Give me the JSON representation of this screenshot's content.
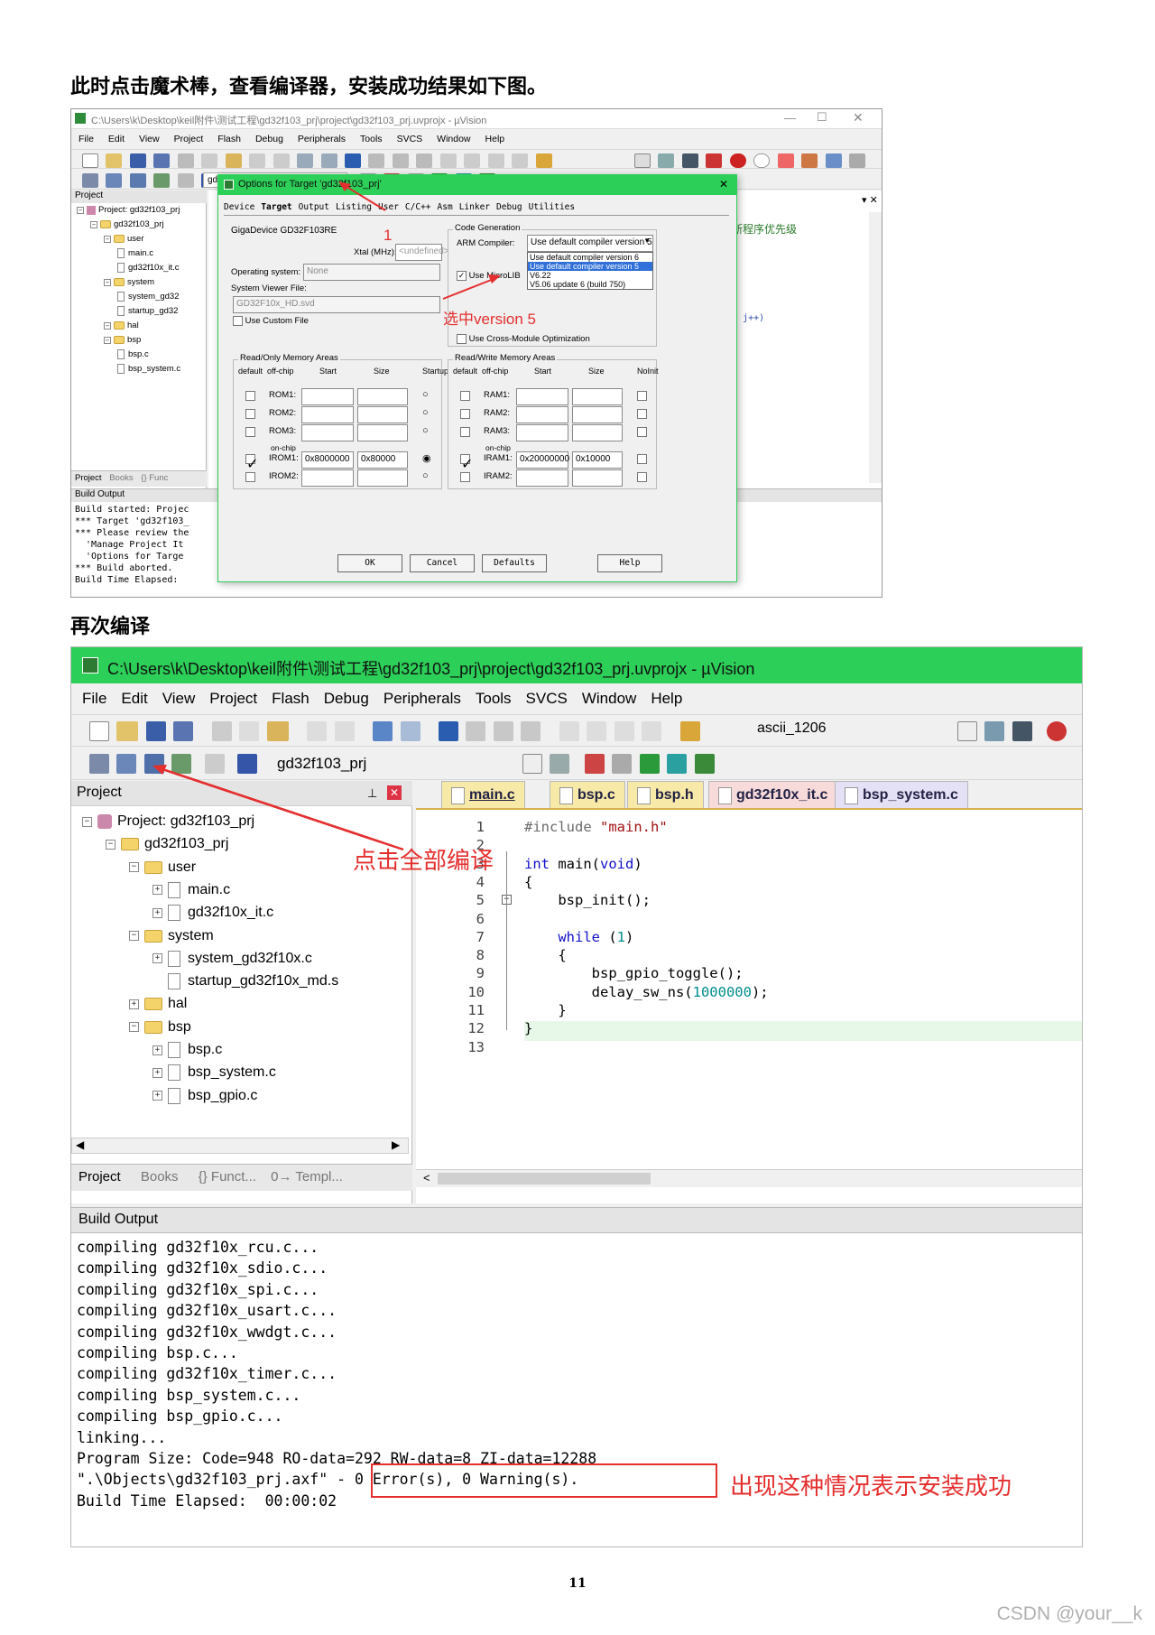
{
  "heading1": "此时点击魔术棒，查看编译器，安装成功结果如下图。",
  "heading2": "再次编译",
  "page_number": "11",
  "watermark": "CSDN @your__k",
  "shot1": {
    "title": "C:\\Users\\k\\Desktop\\keil附件\\测试工程\\gd32f103_prj\\project\\gd32f103_prj.uvprojx - µVision",
    "menu": [
      "File",
      "Edit",
      "View",
      "Project",
      "Flash",
      "Debug",
      "Peripherals",
      "Tools",
      "SVCS",
      "Window",
      "Help"
    ],
    "target": "gd32f103_prj",
    "project_panel_title": "Project",
    "tree": [
      "Project: gd32f103_prj",
      "gd32f103_prj",
      "user",
      "main.c",
      "gd32f10x_it.c",
      "system",
      "system_gd32",
      "startup_gd32",
      "hal",
      "bsp",
      "bsp.c",
      "bsp_system.c"
    ],
    "panel_tabs": [
      "Project",
      "Books",
      "{} Func"
    ],
    "build_output_title": "Build Output",
    "build_lines": [
      "Build started: Projec",
      "*** Target 'gd32f103_",
      "*** Please review the",
      "  'Manage Project It",
      "  'Options for Targe",
      "*** Build aborted.",
      "Build Time Elapsed:"
    ],
    "code_snippets": [
      "中断程序优先级",
      "2U; j++)"
    ],
    "dialog": {
      "title": "Options for Target 'gd32f103_prj'",
      "tabs": [
        "Device",
        "Target",
        "Output",
        "Listing",
        "User",
        "C/C++",
        "Asm",
        "Linker",
        "Debug",
        "Utilities"
      ],
      "device": "GigaDevice GD32F103RE",
      "xtal_label": "Xtal (MHz):",
      "xtal_value": "<undefined>",
      "os_label": "Operating system:",
      "os_value": "None",
      "svd_label": "System Viewer File:",
      "svd_value": "GD32F10x_HD.svd",
      "use_custom_file": "Use Custom File",
      "code_gen_title": "Code Generation",
      "arm_compiler_label": "ARM Compiler:",
      "arm_compiler_value": "Use default compiler version 5",
      "compiler_options": [
        "Use default compiler version 6",
        "Use default compiler version 5",
        "V6.22",
        "V5.06 update 6 (build 750)"
      ],
      "use_microlib": "Use MicroLIB",
      "cross_module": "Use Cross-Module Optimization",
      "ro_title": "Read/Only Memory Areas",
      "rw_title": "Read/Write Memory Areas",
      "ro_headers": [
        "default",
        "off-chip",
        "Start",
        "Size",
        "Startup"
      ],
      "rw_headers": [
        "default",
        "off-chip",
        "Start",
        "Size",
        "NoInit"
      ],
      "ro_rows": [
        {
          "name": "ROM1:",
          "start": "",
          "size": ""
        },
        {
          "name": "ROM2:",
          "start": "",
          "size": ""
        },
        {
          "name": "ROM3:",
          "start": "",
          "size": ""
        },
        {
          "name": "IROM1:",
          "start": "0x8000000",
          "size": "0x80000"
        },
        {
          "name": "IROM2:",
          "start": "",
          "size": ""
        }
      ],
      "rw_rows": [
        {
          "name": "RAM1:",
          "start": "",
          "size": ""
        },
        {
          "name": "RAM2:",
          "start": "",
          "size": ""
        },
        {
          "name": "RAM3:",
          "start": "",
          "size": ""
        },
        {
          "name": "IRAM1:",
          "start": "0x20000000",
          "size": "0x10000"
        },
        {
          "name": "IRAM2:",
          "start": "",
          "size": ""
        }
      ],
      "on_chip": "on-chip",
      "buttons": [
        "OK",
        "Cancel",
        "Defaults",
        "Help"
      ]
    },
    "annotation_1": "1",
    "annotation_version": "选中version 5"
  },
  "shot2": {
    "title": "C:\\Users\\k\\Desktop\\keil附件\\测试工程\\gd32f103_prj\\project\\gd32f103_prj.uvprojx - µVision",
    "menu": [
      "File",
      "Edit",
      "View",
      "Project",
      "Flash",
      "Debug",
      "Peripherals",
      "Tools",
      "SVCS",
      "Window",
      "Help"
    ],
    "search_value": "ascii_1206",
    "target": "gd32f103_prj",
    "project_panel_title": "Project",
    "tree": [
      "Project: gd32f103_prj",
      "gd32f103_prj",
      "user",
      "main.c",
      "gd32f10x_it.c",
      "system",
      "system_gd32f10x.c",
      "startup_gd32f10x_md.s",
      "hal",
      "bsp",
      "bsp.c",
      "bsp_system.c",
      "bsp_gpio.c"
    ],
    "panel_tabs": [
      "Project",
      "Books",
      "{} Funct...",
      "0→ Templ..."
    ],
    "editor_tabs": [
      "main.c",
      "bsp.c",
      "bsp.h",
      "gd32f10x_it.c",
      "bsp_system.c"
    ],
    "code": [
      {
        "n": "1",
        "t": "#include \"main.h\""
      },
      {
        "n": "2",
        "t": ""
      },
      {
        "n": "3",
        "t": "int main(void)"
      },
      {
        "n": "4",
        "t": "{"
      },
      {
        "n": "5",
        "t": "    bsp_init();"
      },
      {
        "n": "6",
        "t": ""
      },
      {
        "n": "7",
        "t": "    while (1)"
      },
      {
        "n": "8",
        "t": "    {"
      },
      {
        "n": "9",
        "t": "        bsp_gpio_toggle();"
      },
      {
        "n": "10",
        "t": "        delay_sw_ns(1000000);"
      },
      {
        "n": "11",
        "t": "    }"
      },
      {
        "n": "12",
        "t": "}"
      },
      {
        "n": "13",
        "t": ""
      }
    ],
    "build_output_title": "Build Output",
    "build_lines": [
      "compiling gd32f10x_rcu.c...",
      "compiling gd32f10x_sdio.c...",
      "compiling gd32f10x_spi.c...",
      "compiling gd32f10x_usart.c...",
      "compiling gd32f10x_wwdgt.c...",
      "compiling bsp.c...",
      "compiling gd32f10x_timer.c...",
      "compiling bsp_system.c...",
      "compiling bsp_gpio.c...",
      "linking...",
      "Program Size: Code=948 RO-data=292 RW-data=8 ZI-data=12288",
      "\".\\Objects\\gd32f103_prj.axf\" - 0 Error(s), 0 Warning(s).",
      "Build Time Elapsed:  00:00:02"
    ],
    "annotation_compile_all": "点击全部编译",
    "annotation_success": "出现这种情况表示安装成功"
  },
  "colors": {
    "green": "#2ccf57",
    "annotation_red": "#e52e2e"
  }
}
